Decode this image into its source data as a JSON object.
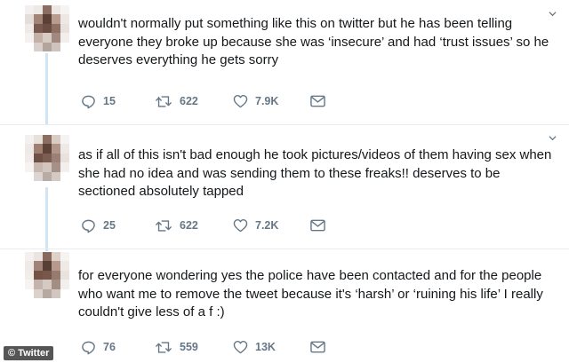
{
  "tweets": [
    {
      "text": "wouldn't normally put something like this on twitter but he has been telling everyone they broke up because she was ‘insecure’ and had ‘trust issues’ so he deserves everything he gets sorry",
      "replies": "15",
      "retweets": "622",
      "likes": "7.9K"
    },
    {
      "text": "as if all of this isn't bad enough he took pictures/videos of them having sex when she had no idea and was sending them to these freaks!! deserves to be sectioned absolutely tapped",
      "replies": "25",
      "retweets": "622",
      "likes": "7.2K"
    },
    {
      "text": "for everyone wondering yes the police have been contacted and for the people who want me to remove the tweet because it's ‘harsh’ or ‘ruining his life’ I really couldn't give less of a f      :)",
      "replies": "76",
      "retweets": "559",
      "likes": "13K"
    }
  ],
  "watermark": "© Twitter",
  "icons": {
    "reply": "reply-icon",
    "retweet": "retweet-icon",
    "like": "heart-icon",
    "message": "direct-message-icon",
    "menu": "chevron-down-icon"
  },
  "colors": {
    "icon_gray": "#657786",
    "thread_line": "#cfe5f5"
  }
}
